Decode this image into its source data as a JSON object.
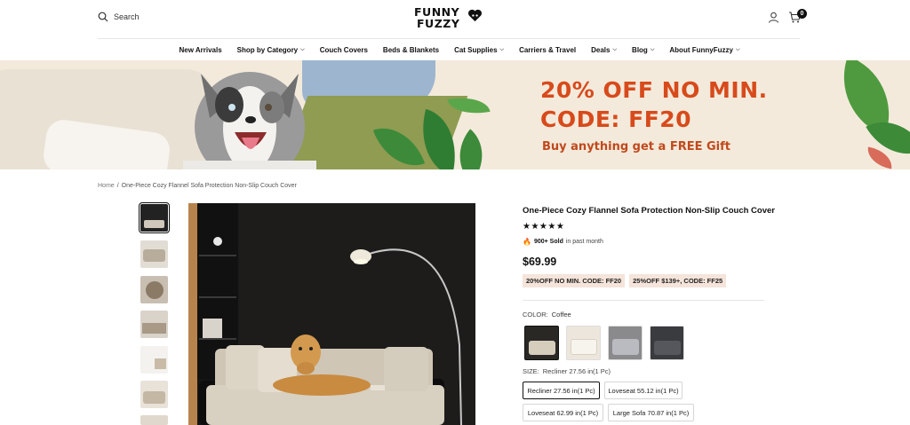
{
  "header": {
    "search_label": "Search",
    "logo_line1": "FUNNY",
    "logo_line2": "FUZZY",
    "cart_count": "0"
  },
  "nav": [
    {
      "label": "New Arrivals",
      "dropdown": false
    },
    {
      "label": "Shop by Category",
      "dropdown": true
    },
    {
      "label": "Couch Covers",
      "dropdown": false
    },
    {
      "label": "Beds & Blankets",
      "dropdown": false
    },
    {
      "label": "Cat Supplies",
      "dropdown": true
    },
    {
      "label": "Carriers & Travel",
      "dropdown": false
    },
    {
      "label": "Deals",
      "dropdown": true
    },
    {
      "label": "Blog",
      "dropdown": true
    },
    {
      "label": "About FunnyFuzzy",
      "dropdown": true
    }
  ],
  "banner": {
    "line1": "20% OFF NO MIN.",
    "line2": "CODE: FF20",
    "line3": "Buy anything get a FREE Gift"
  },
  "breadcrumb": {
    "home": "Home",
    "separator": "/",
    "current": "One-Piece Cozy Flannel Sofa Protection Non-Slip Couch Cover"
  },
  "product": {
    "title": "One-Piece Cozy Flannel Sofa Protection Non-Slip Couch Cover",
    "stars": "★★★★★",
    "sold_icon": "🔥",
    "sold_count": "900+ Sold",
    "sold_suffix": "in past month",
    "price": "$69.99",
    "codes": [
      "20%OFF NO MIN. CODE: FF20",
      "25%OFF $139+, CODE: FF25"
    ],
    "color_label": "COLOR:",
    "color_value": "Coffee",
    "size_label": "SIZE:",
    "size_value": "Recliner 27.56 in(1 Pc)",
    "sizes": [
      "Recliner 27.56 in(1 Pc)",
      "Loveseat 55.12 in(1 Pc)",
      "Loveseat 62.99 in(1 Pc)",
      "Large Sofa 70.87 in(1 Pc)"
    ]
  },
  "colors": {
    "accent": "#d84a1b",
    "code_bg": "#f5e4da",
    "banner_bg": "#f3eadb"
  }
}
